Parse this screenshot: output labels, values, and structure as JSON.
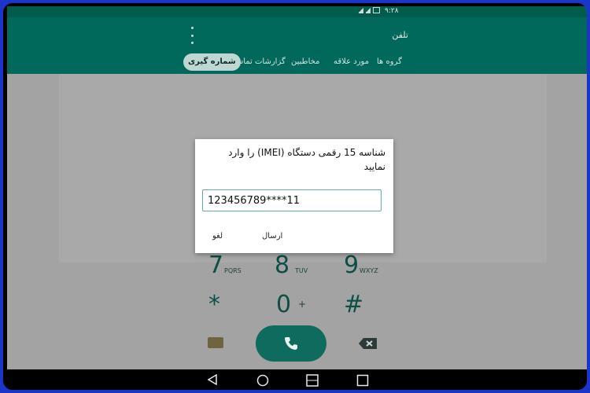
{
  "status_bar": {
    "time": "۹:۲۸"
  },
  "app": {
    "title": "تلفن",
    "tabs": [
      {
        "label": "گروه ها"
      },
      {
        "label": "مورد علاقه"
      },
      {
        "label": "مخاطبین"
      },
      {
        "label": "گزارشات تماس"
      },
      {
        "label": "شماره گیری"
      }
    ]
  },
  "dialpad": {
    "keys": [
      {
        "num": "7",
        "letters": "PQRS"
      },
      {
        "num": "8",
        "letters": "TUV"
      },
      {
        "num": "9",
        "letters": "WXYZ"
      },
      {
        "num": "*",
        "letters": ""
      },
      {
        "num": "0",
        "letters": "+"
      },
      {
        "num": "#",
        "letters": ""
      }
    ]
  },
  "dialog": {
    "prompt": "شناسه 15 رقمی دستگاه (IMEI) را وارد نمایید",
    "input_value": "123456789****11",
    "send_label": "ارسال",
    "cancel_label": "لغو"
  }
}
